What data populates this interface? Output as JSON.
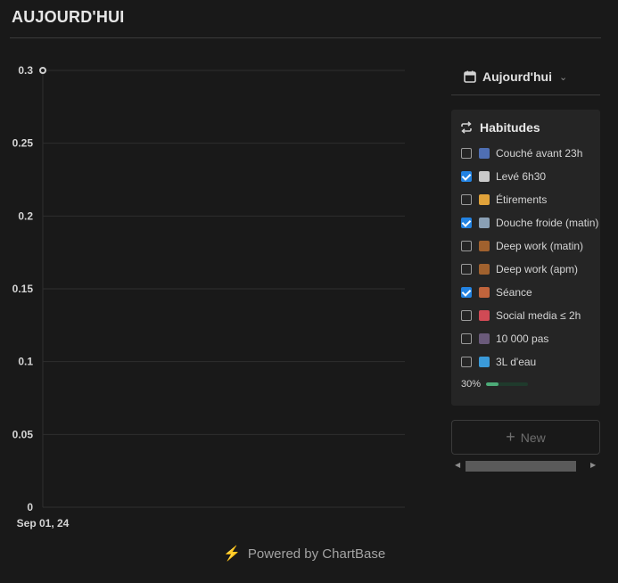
{
  "page": {
    "title": "AUJOURD'HUI"
  },
  "chart_data": {
    "type": "line",
    "x": [
      "Sep 01, 24"
    ],
    "series": [
      {
        "values": [
          0.3
        ]
      }
    ],
    "yticks": [
      "0",
      "0.05",
      "0.1",
      "0.15",
      "0.2",
      "0.25",
      "0.3"
    ],
    "ylim": [
      0,
      0.3
    ],
    "grid": true,
    "colors": {
      "line": "#cfcfcf",
      "grid": "#2e2e2e",
      "axis_text": "#d4d4d4"
    }
  },
  "footer": {
    "powered_by": "Powered by ChartBase"
  },
  "view_selector": {
    "label": "Aujourd'hui"
  },
  "habits_card": {
    "title": "Habitudes",
    "items": [
      {
        "label": "Couché avant 23h",
        "checked": false,
        "icon": "bed-icon",
        "color": "#4f6fb3"
      },
      {
        "label": "Levé 6h30",
        "checked": true,
        "icon": "stopwatch-icon",
        "color": "#c9c9c9"
      },
      {
        "label": "Étirements",
        "checked": false,
        "icon": "person-stretch-icon",
        "color": "#e0a23a"
      },
      {
        "label": "Douche froide (matin)",
        "checked": true,
        "icon": "shower-icon",
        "color": "#8aa0b5"
      },
      {
        "label": "Deep work (matin)",
        "checked": false,
        "icon": "briefcase-icon",
        "color": "#a0612e"
      },
      {
        "label": "Deep work (apm)",
        "checked": false,
        "icon": "briefcase-icon",
        "color": "#a0612e"
      },
      {
        "label": "Séance",
        "checked": true,
        "icon": "dumbbell-icon",
        "color": "#c0643c"
      },
      {
        "label": "Social media ≤ 2h",
        "checked": false,
        "icon": "phone-icon",
        "color": "#d04a55"
      },
      {
        "label": "10 000 pas",
        "checked": false,
        "icon": "footprints-icon",
        "color": "#6a5a7a"
      },
      {
        "label": "3L d'eau",
        "checked": false,
        "icon": "water-drop-icon",
        "color": "#3a9ad9"
      }
    ],
    "progress_label": "30%",
    "progress_fraction": 0.3
  },
  "new_button": {
    "label": "New"
  }
}
